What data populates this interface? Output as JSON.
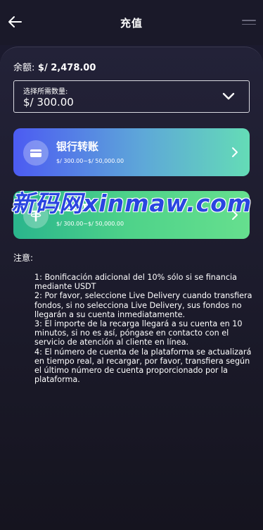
{
  "header": {
    "title": "充值"
  },
  "balance": {
    "label": "余额:",
    "value": "$/ 2,478.00"
  },
  "amount": {
    "label": "选择所需数量:",
    "value": "$/ 300.00"
  },
  "methods": [
    {
      "name": "银行转账",
      "range": "$/ 300.00~$/ 50,000.00",
      "icon": "card-icon"
    },
    {
      "name": "USDT",
      "range": "$/ 300.00~$/ 50,000.00",
      "icon": "tether-icon"
    }
  ],
  "notes": {
    "title": "注意:",
    "lines": [
      "1: Bonificación adicional del 10% sólo si se financia mediante USDT",
      "2: Por favor, seleccione Live Delivery cuando transfiera fondos, si no selecciona Live Delivery, sus fondos no llegarán a su cuenta inmediatamente.",
      "3: El importe de la recarga llegará a su cuenta en 10 minutos, si no es así, póngase en contacto con el servicio de atención al cliente en línea.",
      "4: El número de cuenta de la plataforma se actualizará en tiempo real, al recargar, por favor, transfiera según el último número de cuenta proporcionado por la plataforma."
    ]
  },
  "watermark": "新码网xinmaw.com",
  "colors": {
    "bank_gradient_start": "#4c5bf2",
    "bank_gradient_end": "#64dcb6",
    "usdt_gradient_start": "#2ab58c",
    "usdt_gradient_end": "#66df8e",
    "background": "#1b1a2e"
  }
}
